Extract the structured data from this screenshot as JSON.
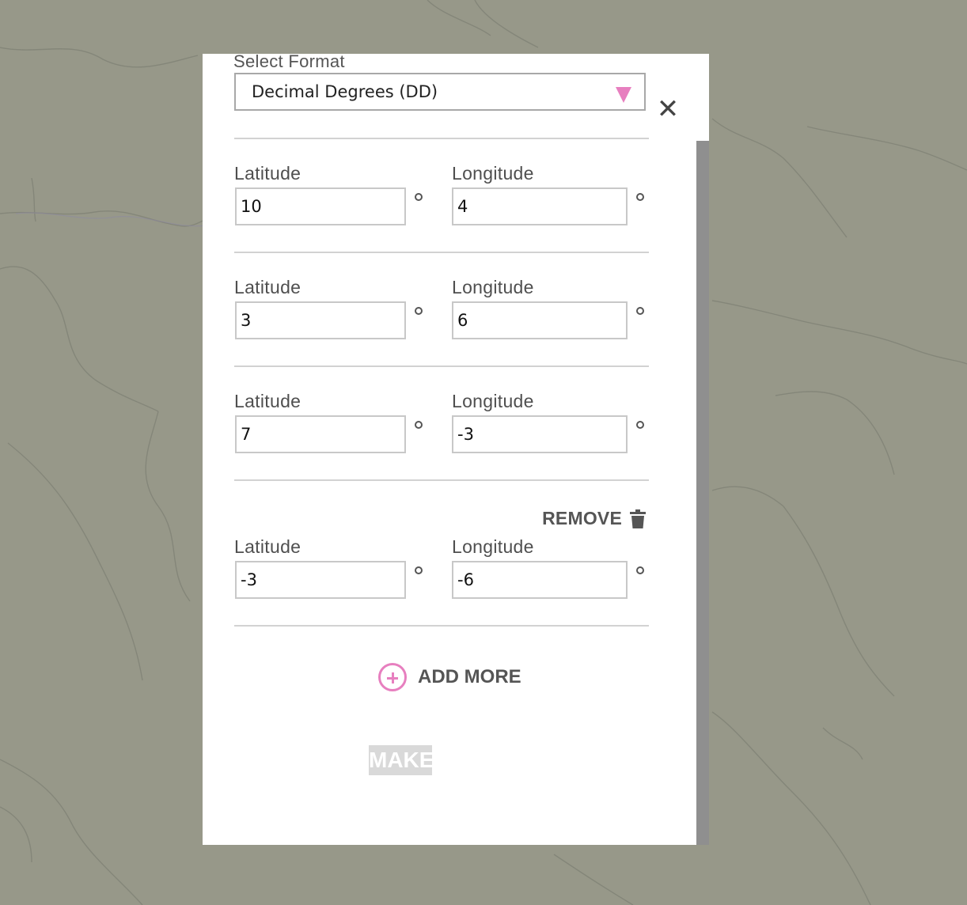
{
  "modal": {
    "select_format_label": "Select Format",
    "selected_format": "Decimal Degrees (DD)",
    "close_glyph": "✕"
  },
  "coordinates": [
    {
      "latitude_label": "Latitude",
      "longitude_label": "Longitude",
      "latitude": "10",
      "longitude": "4"
    },
    {
      "latitude_label": "Latitude",
      "longitude_label": "Longitude",
      "latitude": "3",
      "longitude": "6"
    },
    {
      "latitude_label": "Latitude",
      "longitude_label": "Longitude",
      "latitude": "7",
      "longitude": "-3"
    },
    {
      "latitude_label": "Latitude",
      "longitude_label": "Longitude",
      "latitude": "-3",
      "longitude": "-6"
    }
  ],
  "remove_label": "REMOVE",
  "add_more_label": "ADD MORE",
  "make_label": "MAKE",
  "icons": {
    "close": "close-icon",
    "dropdown": "triangle-down-icon",
    "trash": "trash-icon",
    "add": "plus-circle-icon"
  },
  "colors": {
    "accent": "#e77fbf",
    "map_background": "#979889",
    "river": "#7f8276"
  }
}
